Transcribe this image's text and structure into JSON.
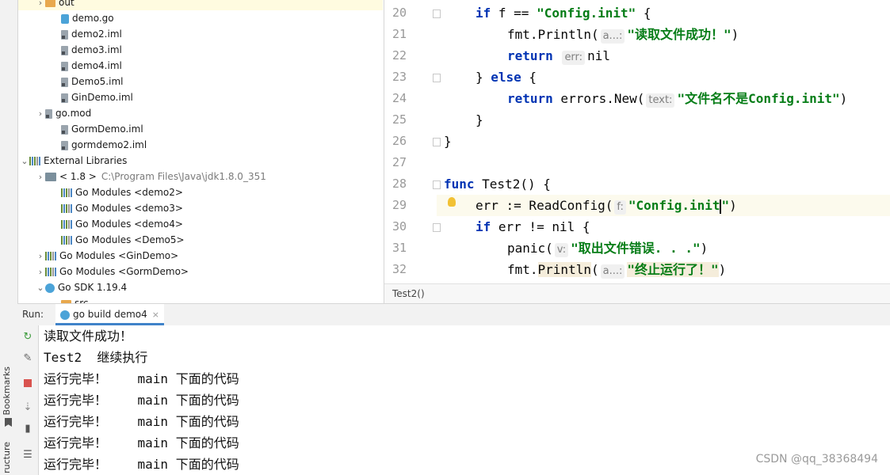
{
  "sidebar": {
    "bookmarks_label": "Bookmarks",
    "structure_label": "ructure"
  },
  "project_tree": {
    "items": [
      {
        "label": "out",
        "kind": "folder",
        "indent": 1,
        "arrow": "›",
        "selected": true
      },
      {
        "label": "demo.go",
        "kind": "gofile",
        "indent": 2
      },
      {
        "label": "demo2.iml",
        "kind": "file",
        "indent": 2
      },
      {
        "label": "demo3.iml",
        "kind": "file",
        "indent": 2
      },
      {
        "label": "demo4.iml",
        "kind": "file",
        "indent": 2
      },
      {
        "label": "Demo5.iml",
        "kind": "file",
        "indent": 2
      },
      {
        "label": "GinDemo.iml",
        "kind": "file",
        "indent": 2
      },
      {
        "label": "go.mod",
        "kind": "file",
        "indent": 1,
        "arrow": "›"
      },
      {
        "label": "GormDemo.iml",
        "kind": "file",
        "indent": 2
      },
      {
        "label": "gormdemo2.iml",
        "kind": "file",
        "indent": 2
      },
      {
        "label": "External Libraries",
        "kind": "libs",
        "indent": 0,
        "arrow": "⌄"
      },
      {
        "label": "< 1.8 >",
        "suffix": "C:\\Program Files\\Java\\jdk1.8.0_351",
        "kind": "jdk",
        "indent": 1,
        "arrow": "›"
      },
      {
        "label": "Go Modules <demo2>",
        "kind": "libs",
        "indent": 2
      },
      {
        "label": "Go Modules <demo3>",
        "kind": "libs",
        "indent": 2
      },
      {
        "label": "Go Modules <demo4>",
        "kind": "libs",
        "indent": 2
      },
      {
        "label": "Go Modules <Demo5>",
        "kind": "libs",
        "indent": 2
      },
      {
        "label": "Go Modules <GinDemo>",
        "kind": "libs",
        "indent": 1,
        "arrow": "›"
      },
      {
        "label": "Go Modules <GormDemo>",
        "kind": "libs",
        "indent": 1,
        "arrow": "›"
      },
      {
        "label": "Go SDK 1.19.4",
        "kind": "sdk",
        "indent": 1,
        "arrow": "⌄"
      },
      {
        "label": "src",
        "kind": "folder",
        "indent": 2,
        "arrow": "⌄"
      }
    ]
  },
  "editor": {
    "breadcrumb": "Test2()",
    "line_numbers": [
      "20",
      "21",
      "22",
      "23",
      "24",
      "25",
      "26",
      "27",
      "28",
      "29",
      "30",
      "31",
      "32"
    ],
    "lines": [
      {
        "indent": 1,
        "parts": [
          {
            "t": "if",
            "c": "kw"
          },
          {
            "t": " f == "
          },
          {
            "t": "\"Config.init\"",
            "c": "str"
          },
          {
            "t": " {"
          }
        ]
      },
      {
        "indent": 2,
        "parts": [
          {
            "t": "fmt.Println("
          },
          {
            "h": "a...:"
          },
          {
            "t": "\"读取文件成功！\"",
            "c": "str"
          },
          {
            "t": ")"
          }
        ]
      },
      {
        "indent": 2,
        "parts": [
          {
            "t": "return",
            "c": "kw"
          },
          {
            "t": " "
          },
          {
            "h": "err:"
          },
          {
            "t": "nil"
          }
        ]
      },
      {
        "indent": 1,
        "parts": [
          {
            "t": "} "
          },
          {
            "t": "else",
            "c": "kw"
          },
          {
            "t": " {"
          }
        ]
      },
      {
        "indent": 2,
        "parts": [
          {
            "t": "return",
            "c": "kw"
          },
          {
            "t": " errors.New("
          },
          {
            "h": "text:"
          },
          {
            "t": "\"文件名不是Config.init\"",
            "c": "str"
          },
          {
            "t": ")"
          }
        ]
      },
      {
        "indent": 1,
        "parts": [
          {
            "t": "}"
          }
        ]
      },
      {
        "indent": 0,
        "parts": [
          {
            "t": "}"
          }
        ]
      },
      {
        "indent": 0,
        "parts": []
      },
      {
        "indent": 0,
        "parts": [
          {
            "t": "func",
            "c": "kw"
          },
          {
            "t": " Test2() {"
          }
        ]
      },
      {
        "indent": 1,
        "parts": [
          {
            "t": "err := ReadConfig("
          },
          {
            "h": "f:"
          },
          {
            "t": "\"Config.init",
            "c": "str"
          },
          {
            "caret": true
          },
          {
            "t": "\"",
            "c": "str"
          },
          {
            "t": ")"
          }
        ]
      },
      {
        "indent": 1,
        "parts": [
          {
            "t": "if",
            "c": "kw"
          },
          {
            "t": " err != nil {"
          }
        ]
      },
      {
        "indent": 2,
        "parts": [
          {
            "t": "panic("
          },
          {
            "h": "v:"
          },
          {
            "t": "\"取出文件错误. . .\"",
            "c": "str"
          },
          {
            "t": ")"
          }
        ]
      },
      {
        "indent": 2,
        "parts": [
          {
            "t": "fmt."
          },
          {
            "t": "Println",
            "c": "hl"
          },
          {
            "t": "("
          },
          {
            "h": "a...:"
          },
          {
            "t": "\"终止运行了！\"",
            "c": "str hl"
          },
          {
            "t": ")"
          }
        ]
      }
    ]
  },
  "run_panel": {
    "label": "Run:",
    "tab_label": "go build demo4",
    "tab_close": "×",
    "output": [
      "读取文件成功！",
      "Test2  继续执行",
      "运行完毕！    main 下面的代码",
      "运行完毕！    main 下面的代码",
      "运行完毕！    main 下面的代码",
      "运行完毕！    main 下面的代码",
      "运行完毕！    main 下面的代码"
    ]
  },
  "watermark": "CSDN @qq_38368494"
}
